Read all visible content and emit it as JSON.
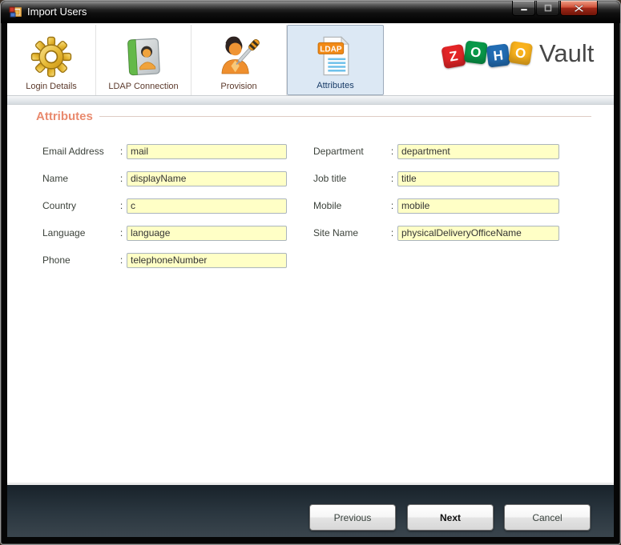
{
  "window": {
    "title": "Import Users"
  },
  "brand": {
    "tiles": [
      {
        "letter": "Z",
        "color": "#e42527"
      },
      {
        "letter": "O",
        "color": "#089949"
      },
      {
        "letter": "H",
        "color": "#226db4"
      },
      {
        "letter": "O",
        "color": "#f9b21d"
      }
    ],
    "product": "Vault"
  },
  "tabs": [
    {
      "label": "Login Details",
      "icon": "gear-icon",
      "selected": false
    },
    {
      "label": "LDAP Connection",
      "icon": "address-book-icon",
      "selected": false
    },
    {
      "label": "Provision",
      "icon": "user-screwdriver-icon",
      "selected": false
    },
    {
      "label": "Attributes",
      "icon": "ldap-document-icon",
      "selected": true
    }
  ],
  "icons": {
    "ldap_badge": "LDAP"
  },
  "section": {
    "heading": "Attributes"
  },
  "form": {
    "colon": ":",
    "left": [
      {
        "label": "Email Address",
        "value": "mail"
      },
      {
        "label": "Name",
        "value": "displayName"
      },
      {
        "label": "Country",
        "value": "c"
      },
      {
        "label": "Language",
        "value": "language"
      },
      {
        "label": "Phone",
        "value": "telephoneNumber"
      }
    ],
    "right": [
      {
        "label": "Department",
        "value": "department"
      },
      {
        "label": "Job title",
        "value": "title"
      },
      {
        "label": "Mobile",
        "value": "mobile"
      },
      {
        "label": "Site Name",
        "value": "physicalDeliveryOfficeName"
      }
    ]
  },
  "footer": {
    "previous_label": "Previous",
    "next_label": "Next",
    "cancel_label": "Cancel"
  },
  "colors": {
    "accent_heading": "#e98a6e",
    "input_bg": "#ffffc6",
    "input_border": "#abb5bd",
    "selected_tab_bg": "#dce8f4",
    "tab_label": "#5b392b",
    "selected_tab_label": "#173a66",
    "footer_bg": "#2b3740",
    "close_button": "#c23b26",
    "titlebar": "#000000"
  }
}
